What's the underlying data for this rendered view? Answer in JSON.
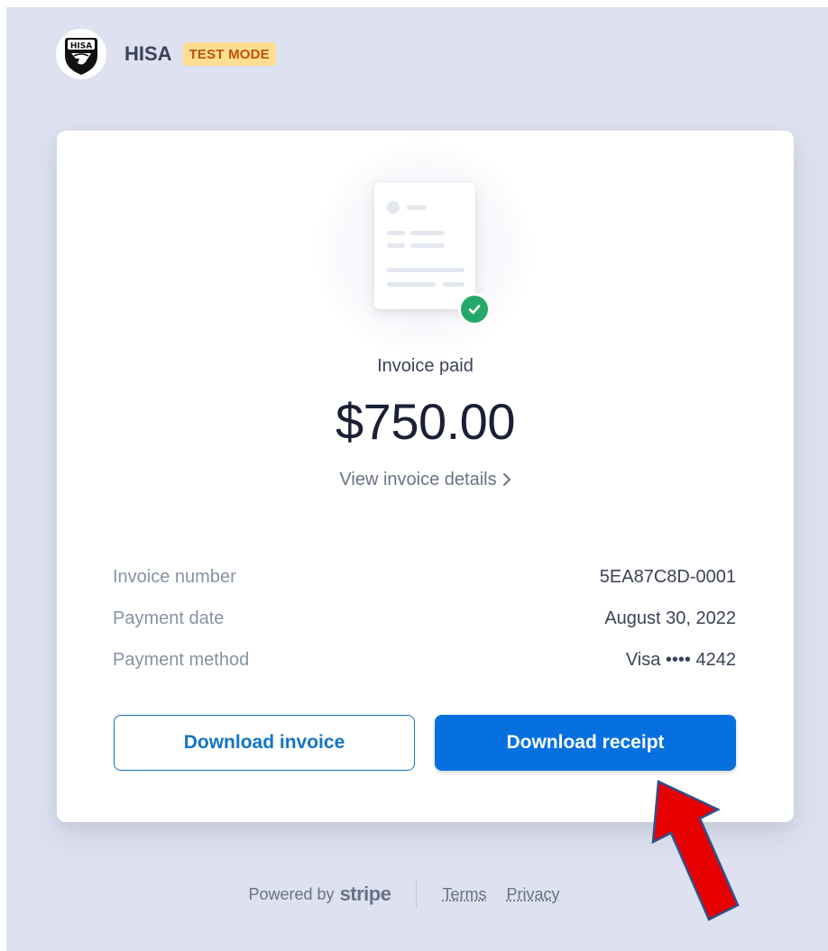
{
  "brand": {
    "name": "HISA",
    "logo_text": "HISA",
    "test_badge": "TEST MODE"
  },
  "invoice": {
    "status": "Invoice paid",
    "amount": "$750.00",
    "details_link": "View invoice details"
  },
  "details": [
    {
      "label": "Invoice number",
      "value": "5EA87C8D-0001"
    },
    {
      "label": "Payment date",
      "value": "August 30, 2022"
    },
    {
      "label": "Payment method",
      "value": "Visa •••• 4242"
    }
  ],
  "buttons": {
    "download_invoice": "Download invoice",
    "download_receipt": "Download receipt"
  },
  "footer": {
    "powered_by": "Powered by",
    "stripe": "stripe",
    "terms": "Terms",
    "privacy": "Privacy"
  },
  "colors": {
    "background": "#dde1f0",
    "accent": "#0570de",
    "success": "#25a96a",
    "badge_bg": "#ffde92",
    "badge_text": "#bb5504",
    "annotation_arrow": "#e60000"
  },
  "icons": {
    "logo": "hisa-logo-icon",
    "check": "check-circle-icon",
    "chevron": "chevron-right-icon",
    "document": "invoice-document-icon",
    "annotation": "red-arrow-icon"
  }
}
